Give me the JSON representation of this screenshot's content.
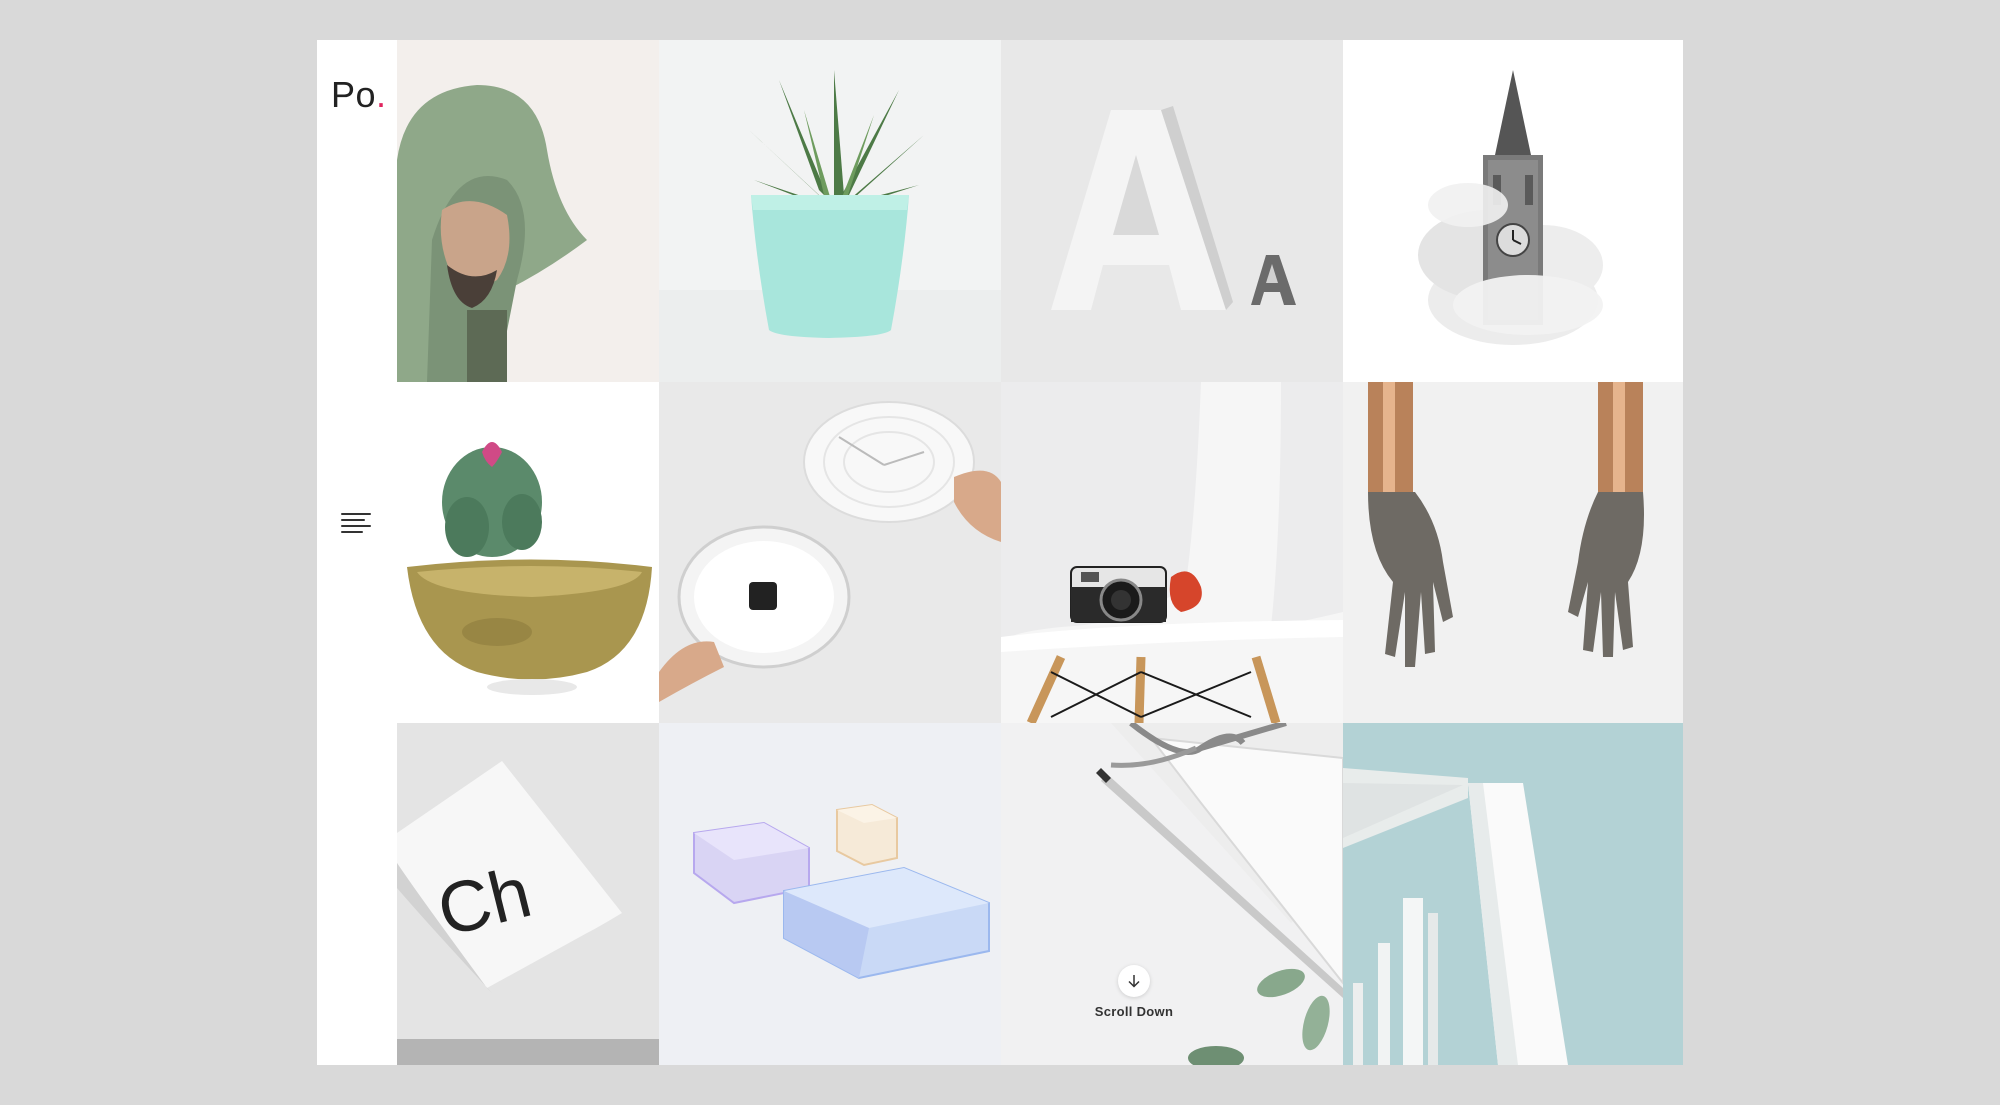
{
  "logo": {
    "text": "Po",
    "dot": "."
  },
  "menu": {
    "icon": "hamburger-menu-icon"
  },
  "scroll": {
    "label": "Scroll Down",
    "icon": "arrow-down-icon"
  },
  "colors": {
    "accent": "#e0245e",
    "background": "#d9d9d9",
    "frame": "#ffffff"
  },
  "gallery": [
    {
      "subject": "hooded-man"
    },
    {
      "subject": "succulent-mint-pot"
    },
    {
      "subject": "letter-a-sculpture"
    },
    {
      "subject": "clock-tower-clouds"
    },
    {
      "subject": "cactus-brass-pot"
    },
    {
      "subject": "white-wall-clock"
    },
    {
      "subject": "camera-on-chair"
    },
    {
      "subject": "bronze-hands"
    },
    {
      "subject": "ch-typography-paper"
    },
    {
      "subject": "glass-blocks"
    },
    {
      "subject": "pencil-notebook"
    },
    {
      "subject": "white-building"
    }
  ]
}
